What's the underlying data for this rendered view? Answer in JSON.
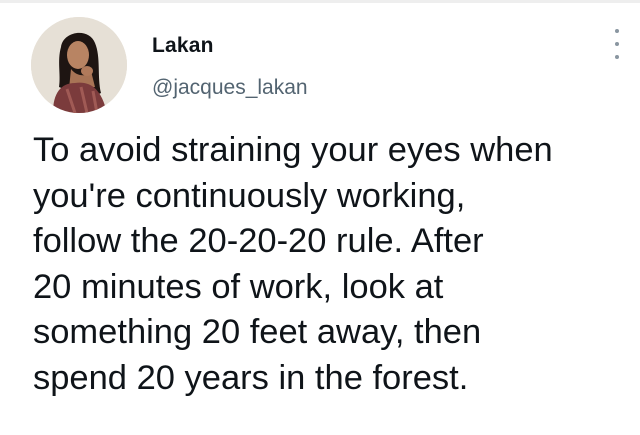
{
  "author": {
    "display_name": "Lakan",
    "handle": "@jacques_lakan"
  },
  "tweet": {
    "lines": [
      "To avoid straining your eyes when",
      "you're continuously working,",
      "follow the 20-20-20 rule. After",
      "20 minutes of work, look at",
      "something 20 feet away, then",
      "spend 20 years in the forest."
    ]
  },
  "icons": {
    "more": "vertical-ellipsis-icon"
  },
  "colors": {
    "text": "#0f1419",
    "secondary_text": "#536471",
    "more_icon": "#8a96a1"
  }
}
